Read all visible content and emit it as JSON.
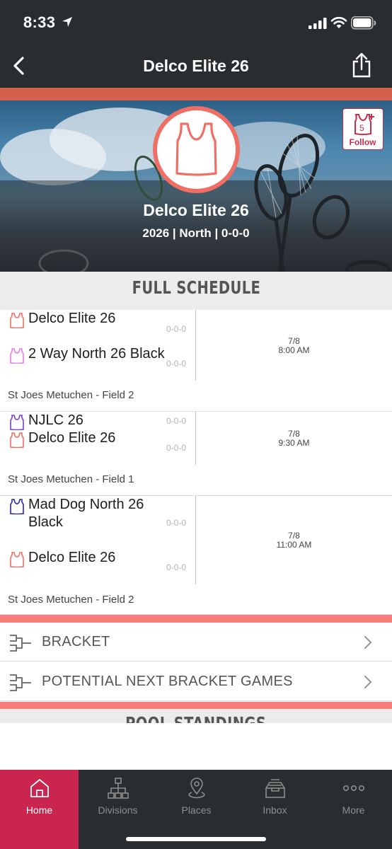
{
  "status": {
    "time": "8:33"
  },
  "nav": {
    "title": "Delco Elite 26"
  },
  "hero": {
    "name": "Delco Elite 26",
    "subtitle": "2026 | North | 0-0-0",
    "follow_label": "Follow",
    "follow_count": "5"
  },
  "schedule": {
    "heading": "FULL SCHEDULE",
    "games": [
      {
        "team1": "Delco Elite 26",
        "team1_record": "0-0-0",
        "team1_color": "#f06e63",
        "team2": "2 Way North 26 Black",
        "team2_record": "0-0-0",
        "team2_color": "#f07ae8",
        "date": "7/8",
        "time": "8:00 AM",
        "venue": "St Joes Metuchen - Field 2"
      },
      {
        "team1": "NJLC 26",
        "team1_record": "0-0-0",
        "team1_color": "#7a3fd1",
        "team2": "Delco Elite 26",
        "team2_record": "0-0-0",
        "team2_color": "#f06e63",
        "date": "7/8",
        "time": "9:30 AM",
        "venue": "St Joes Metuchen - Field 1"
      },
      {
        "team1": "Mad Dog North 26 Black",
        "team1_record": "0-0-0",
        "team1_color": "#2a2aa0",
        "team2": "Delco Elite 26",
        "team2_record": "0-0-0",
        "team2_color": "#f06e63",
        "date": "7/8",
        "time": "11:00 AM",
        "venue": "St Joes Metuchen - Field 2"
      }
    ]
  },
  "links": [
    {
      "label": "BRACKET",
      "icon": "bracket-icon"
    },
    {
      "label": "POTENTIAL NEXT BRACKET GAMES",
      "icon": "bracket-icon"
    }
  ],
  "pool": {
    "heading": "POOL STANDINGS"
  },
  "tabs": [
    {
      "label": "Home",
      "icon": "home-icon",
      "active": true
    },
    {
      "label": "Divisions",
      "icon": "divisions-icon"
    },
    {
      "label": "Places",
      "icon": "places-icon"
    },
    {
      "label": "Inbox",
      "icon": "inbox-icon"
    },
    {
      "label": "More",
      "icon": "more-icon"
    }
  ],
  "colors": {
    "accent": "#d4604b",
    "active_tab": "#c9254f",
    "separator": "#f67d7a",
    "dark": "#2a2d30"
  }
}
